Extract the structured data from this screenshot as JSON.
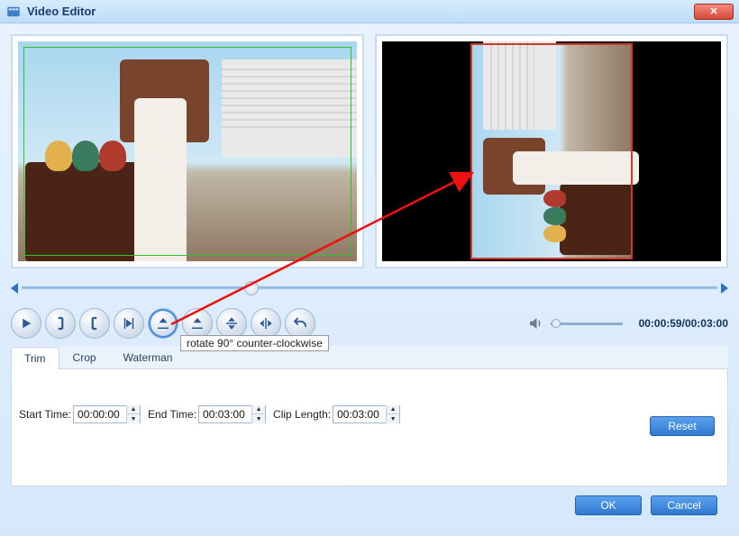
{
  "window": {
    "title": "Video Editor"
  },
  "tooltip": "rotate 90° counter-clockwise",
  "timecode": {
    "current": "00:00:59",
    "total": "00:03:00"
  },
  "tabs": {
    "trim": "Trim",
    "crop": "Crop",
    "watermark": "Waterman",
    "active": "trim"
  },
  "trim": {
    "start_label": "Start Time:",
    "start_value": "00:00:00",
    "end_label": "End Time:",
    "end_value": "00:03:00",
    "clip_label": "Clip Length:",
    "clip_value": "00:03:00",
    "reset": "Reset"
  },
  "footer": {
    "ok": "OK",
    "cancel": "Cancel"
  },
  "icons": {
    "play": "play-icon",
    "mark_in": "mark-in-icon",
    "mark_out": "mark-out-icon",
    "play_range": "play-range-icon",
    "rotate_ccw": "rotate-ccw-icon",
    "rotate_cw": "rotate-cw-icon",
    "flip_v": "flip-vertical-icon",
    "flip_h": "flip-horizontal-icon",
    "undo": "undo-icon"
  }
}
